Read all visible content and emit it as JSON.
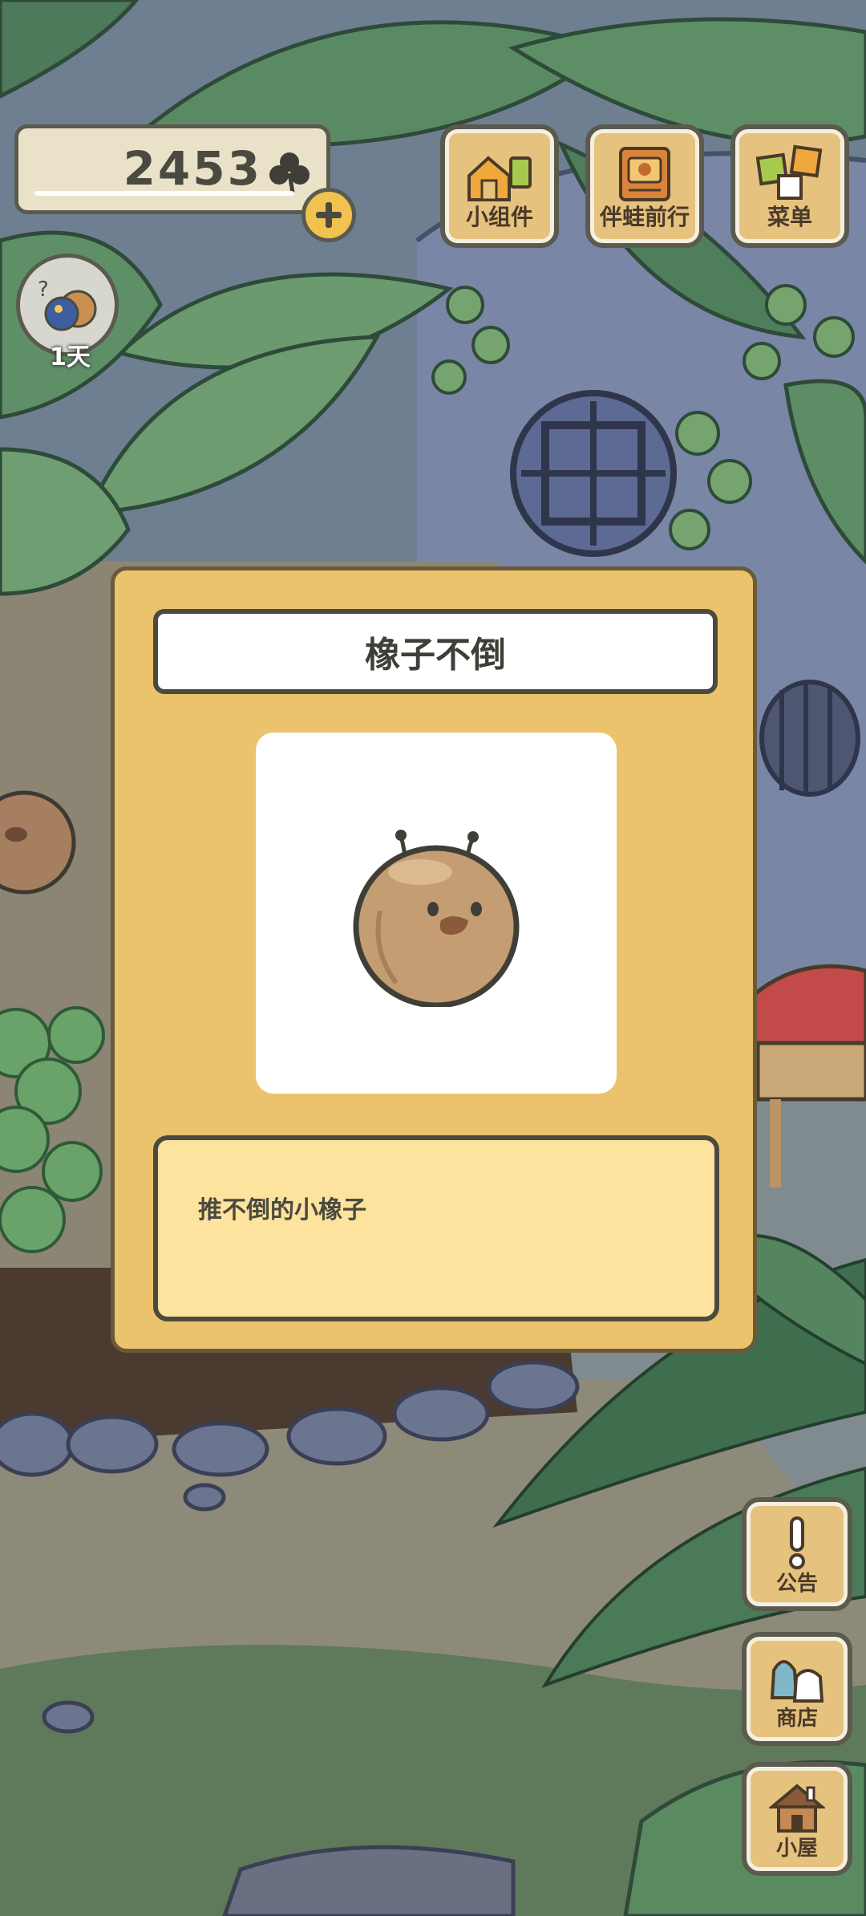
{
  "hud": {
    "clover_count": "2453",
    "avatar_days": "1天"
  },
  "top_buttons": [
    {
      "label": "小组件",
      "icon": "widget-icon"
    },
    {
      "label": "伴蛙前行",
      "icon": "journal-icon"
    },
    {
      "label": "菜单",
      "icon": "menu-icon"
    }
  ],
  "side_buttons": [
    {
      "label": "公告",
      "icon": "exclamation-icon"
    },
    {
      "label": "商店",
      "icon": "shop-bags-icon"
    },
    {
      "label": "小屋",
      "icon": "house-icon"
    }
  ],
  "dialog": {
    "title": "橡子不倒",
    "description": "推不倒的小橡子",
    "item_icon": "acorn-tumbler-icon"
  },
  "colors": {
    "dialog_bg": "#ebc36d",
    "desc_bg": "#fde39d",
    "button_bg": "#e6c27f",
    "outline": "#4a4a40"
  }
}
